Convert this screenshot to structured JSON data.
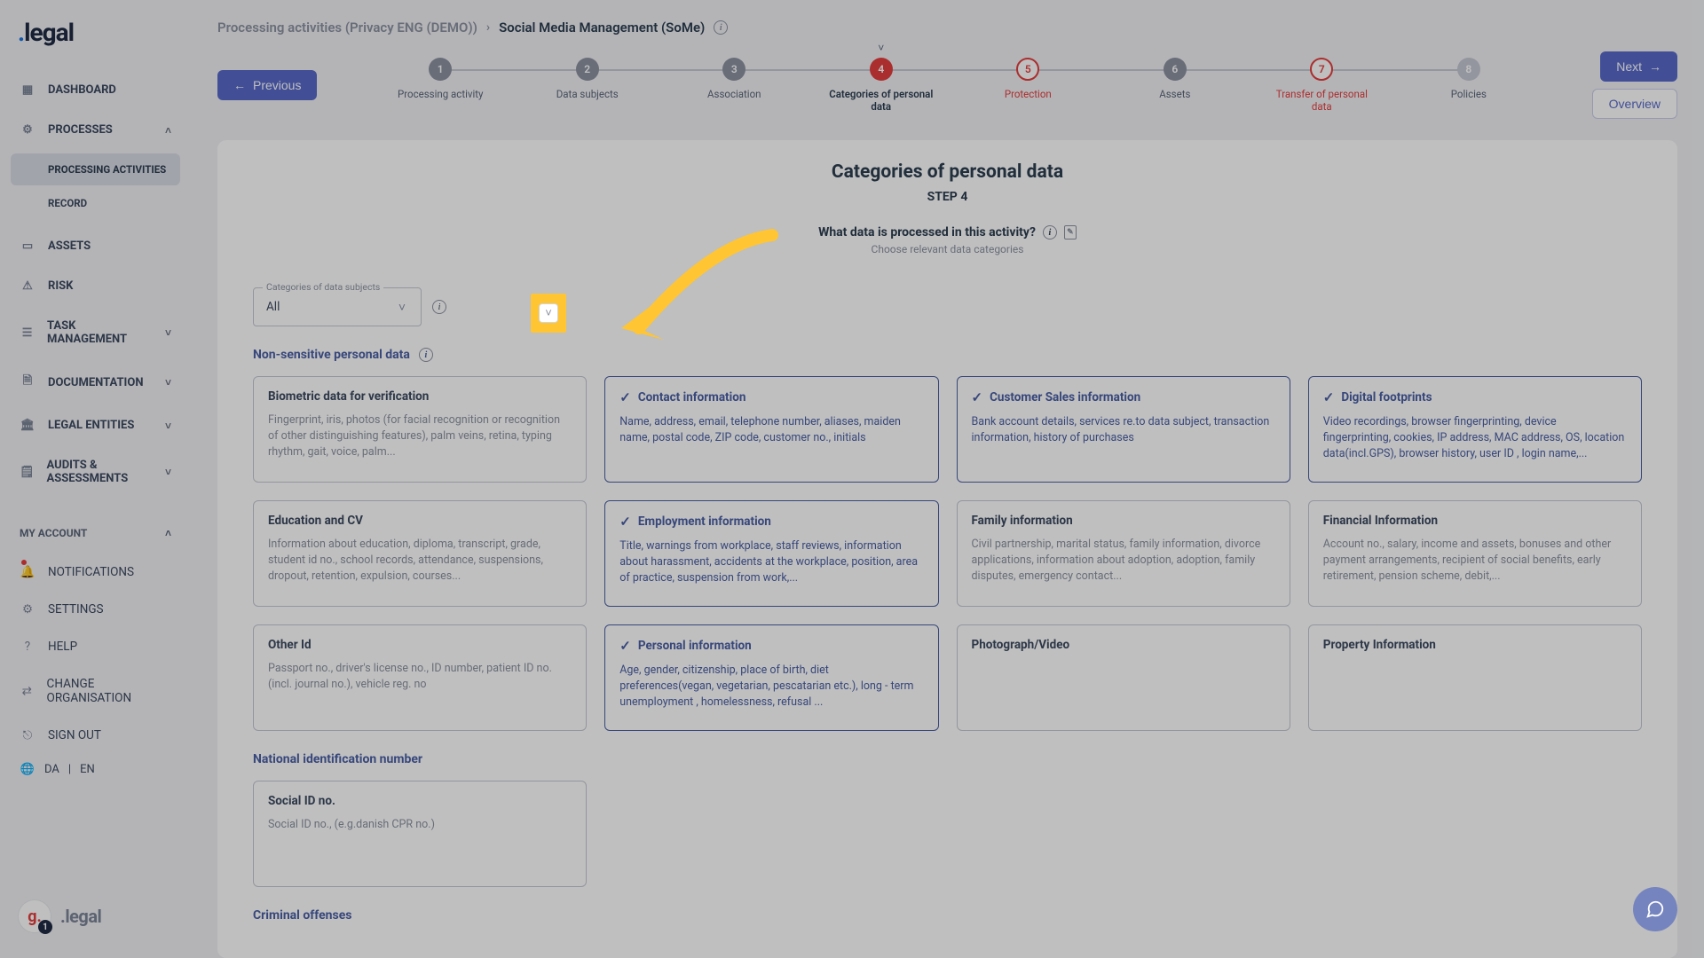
{
  "logo": ".legal",
  "sidebar": {
    "items": [
      {
        "label": "DASHBOARD"
      },
      {
        "label": "PROCESSES"
      },
      {
        "label": "ASSETS"
      },
      {
        "label": "RISK"
      },
      {
        "label": "TASK MANAGEMENT"
      },
      {
        "label": "DOCUMENTATION"
      },
      {
        "label": "LEGAL ENTITIES"
      },
      {
        "label": "AUDITS & ASSESSMENTS"
      }
    ],
    "processes_sub": [
      {
        "label": "PROCESSING ACTIVITIES"
      },
      {
        "label": "RECORD"
      }
    ],
    "account_header": "MY ACCOUNT",
    "account_items": [
      {
        "label": "NOTIFICATIONS"
      },
      {
        "label": "SETTINGS"
      },
      {
        "label": "HELP"
      },
      {
        "label": "CHANGE ORGANISATION"
      },
      {
        "label": "SIGN OUT"
      }
    ],
    "lang_da": "DA",
    "lang_sep": "|",
    "lang_en": "EN",
    "g_badge": "g.",
    "g_count": "1",
    "footer_brand": ".legal"
  },
  "breadcrumbs": {
    "parent": "Processing activities (Privacy ENG (DEMO))",
    "current": "Social Media Management (SoMe)"
  },
  "nav": {
    "prev": "Previous",
    "next": "Next",
    "overview": "Overview"
  },
  "steps": [
    {
      "num": "1",
      "label": "Processing activity"
    },
    {
      "num": "2",
      "label": "Data subjects"
    },
    {
      "num": "3",
      "label": "Association"
    },
    {
      "num": "4",
      "label": "Categories of personal data"
    },
    {
      "num": "5",
      "label": "Protection"
    },
    {
      "num": "6",
      "label": "Assets"
    },
    {
      "num": "7",
      "label": "Transfer of personal data"
    },
    {
      "num": "8",
      "label": "Policies"
    }
  ],
  "page": {
    "title": "Categories of personal data",
    "step_sub": "STEP 4",
    "prompt": "What data is processed in this activity?",
    "prompt_sub": "Choose relevant data categories"
  },
  "filter": {
    "label": "Categories of data subjects",
    "value": "All"
  },
  "sections": {
    "nonsensitive": "Non-sensitive personal data",
    "national": "National identification number",
    "criminal": "Criminal offenses"
  },
  "cards": {
    "nonsensitive": [
      {
        "title": "Biometric data for verification",
        "desc": "Fingerprint, iris, photos (for facial recognition or recognition of other distinguishing features), palm veins, retina, typing rhythm, gait, voice, palm...",
        "selected": false
      },
      {
        "title": "Contact information",
        "desc": "Name, address, email, telephone number, aliases, maiden name, postal code, ZIP code, customer no., initials",
        "selected": true
      },
      {
        "title": "Customer Sales information",
        "desc": "Bank account details, services re.to data subject, transaction information, history of purchases",
        "selected": true
      },
      {
        "title": "Digital footprints",
        "desc": "Video recordings, browser fingerprinting, device fingerprinting, cookies, IP address, MAC address, OS, location data(incl.GPS), browser history, user ID , login name,...",
        "selected": true
      },
      {
        "title": "Education and CV",
        "desc": "Information about education, diploma, transcript, grade, student id no., school records, attendance, suspensions, dropout, retention, expulsion, courses...",
        "selected": false
      },
      {
        "title": "Employment information",
        "desc": "Title, warnings from workplace, staff reviews, information about harassment, accidents at the workplace, position, area of practice, suspension from work,...",
        "selected": true
      },
      {
        "title": "Family information",
        "desc": "Civil partnership, marital status, family information, divorce applications, information about adoption, adoption, family disputes, emergency contact...",
        "selected": false
      },
      {
        "title": "Financial Information",
        "desc": "Account no., salary, income and assets, bonuses and other payment arrangements, recipient of social benefits, early retirement, pension scheme, debit,...",
        "selected": false
      },
      {
        "title": "Other Id",
        "desc": "Passport no., driver's license no., ID number, patient ID no. (incl. journal no.), vehicle reg. no",
        "selected": false
      },
      {
        "title": "Personal information",
        "desc": "Age, gender, citizenship, place of birth, diet preferences(vegan, vegetarian, pescatarian etc.), long - term unemployment , homelessness, refusal ...",
        "selected": true
      },
      {
        "title": "Photograph/Video",
        "desc": "",
        "selected": false
      },
      {
        "title": "Property Information",
        "desc": "",
        "selected": false
      }
    ],
    "national": [
      {
        "title": "Social ID no.",
        "desc": "Social ID no., (e.g.danish CPR no.)",
        "selected": false
      }
    ]
  }
}
